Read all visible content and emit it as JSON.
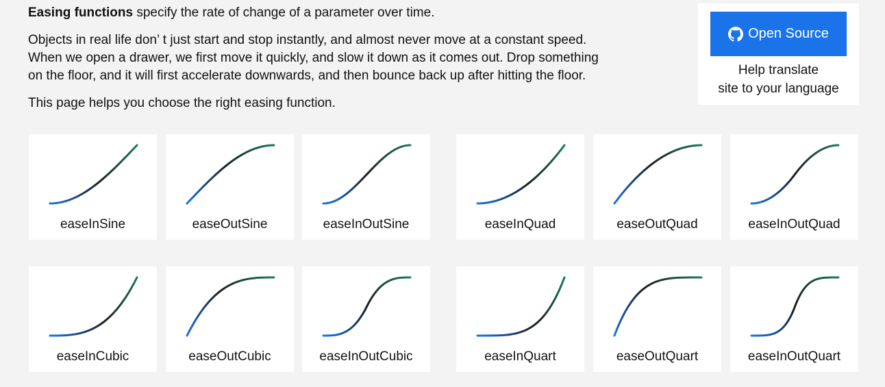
{
  "intro": {
    "lead_bold": "Easing functions",
    "lead_rest": " specify the rate of change of a parameter over time.",
    "desc_line1": "Objects in real life don’ t just start and stop instantly, and almost never move at a constant speed.",
    "desc_line2": "When we open a drawer, we first move it quickly, and slow it down as it comes out. Drop something",
    "desc_line3": "on the floor, and it will first accelerate downwards, and then bounce back up after hitting the floor.",
    "help_text": "This page helps you choose the right easing function."
  },
  "open_source": {
    "button_label": "Open Source",
    "icon": "github-icon",
    "help_line1": "Help translate",
    "help_line2": "site to your language"
  },
  "colors": {
    "page_background": "#f3f3f3",
    "card_background": "#ffffff",
    "button_blue": "#1a73e8",
    "curve_start_blue": "#1a73e8",
    "curve_mid_black": "#1c1c1c",
    "curve_end_green": "#1a7a55"
  },
  "easings": [
    {
      "name": "easeInSine"
    },
    {
      "name": "easeOutSine"
    },
    {
      "name": "easeInOutSine"
    },
    {
      "name": "easeInQuad"
    },
    {
      "name": "easeOutQuad"
    },
    {
      "name": "easeInOutQuad"
    },
    {
      "name": "easeInCubic"
    },
    {
      "name": "easeOutCubic"
    },
    {
      "name": "easeInOutCubic"
    },
    {
      "name": "easeInQuart"
    },
    {
      "name": "easeOutQuart"
    },
    {
      "name": "easeInOutQuart"
    }
  ]
}
